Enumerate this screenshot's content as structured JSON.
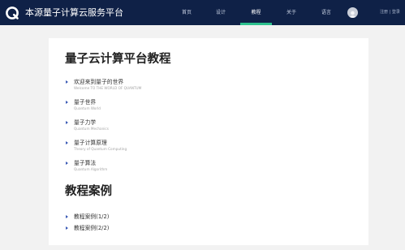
{
  "header": {
    "brand": "本源量子计算云服务平台",
    "nav": [
      "首页",
      "设计",
      "教程",
      "关于",
      "语言"
    ],
    "active_tab": "教程",
    "auth": {
      "register": "注册",
      "separator": "|",
      "login": "登录"
    }
  },
  "main": {
    "heading": "量子云计算平台教程",
    "tutorials": [
      {
        "title": "欢迎来到量子的世界",
        "subtitle": "Welcome TO THE WORLD OF QUANTUM"
      },
      {
        "title": "量子世界",
        "subtitle": "Quantum World"
      },
      {
        "title": "量子力学",
        "subtitle": "Quantum Mechanics"
      },
      {
        "title": "量子计算原理",
        "subtitle": "Theory of Quantum Computing"
      },
      {
        "title": "量子算法",
        "subtitle": "Quantum Algorithm"
      }
    ],
    "cases_heading": "教程案例",
    "cases": [
      "教程案例(1/2)",
      "教程案例(2/2)"
    ]
  },
  "colors": {
    "header_bg": "#0f2147",
    "accent": "#2dc08e",
    "bullet": "#3b5bb5",
    "page_bg": "#f2f2f2"
  },
  "icons": {
    "logo": "q-logo-icon",
    "avatar": "user-avatar-icon",
    "bullet": "triangle-right-icon"
  }
}
